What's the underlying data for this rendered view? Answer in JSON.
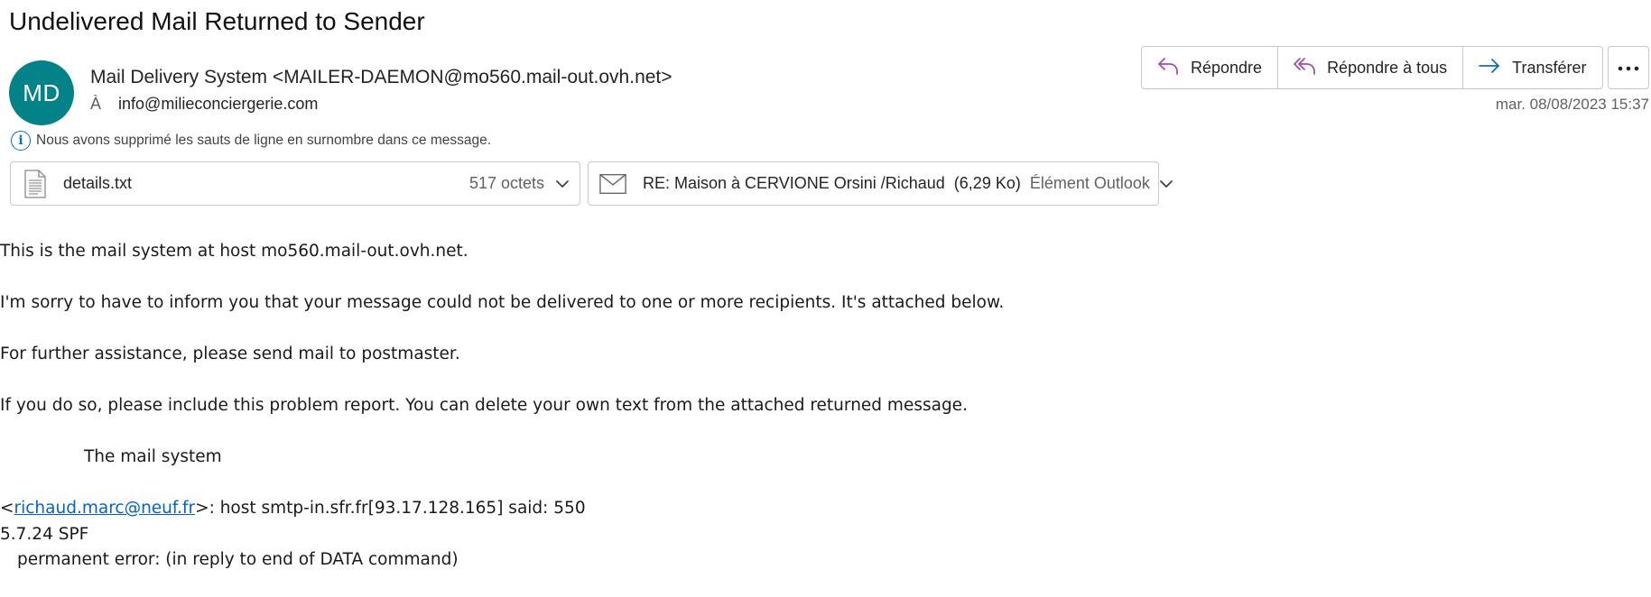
{
  "message": {
    "subject": "Undelivered Mail Returned to Sender",
    "avatar_initials": "MD",
    "avatar_color": "#038387",
    "sender": "Mail Delivery System <MAILER-DAEMON@mo560.mail-out.ovh.net>",
    "to_label": "À",
    "to": "info@milieconciergerie.com",
    "date": "mar. 08/08/2023 15:37",
    "info_notice": "Nous avons supprimé les sauts de ligne en surnombre dans ce message."
  },
  "actions": {
    "reply": "Répondre",
    "reply_all": "Répondre à tous",
    "forward": "Transférer",
    "more_icon": "more-dots-icon",
    "accent": "#a34bb0"
  },
  "attachments": [
    {
      "name": "details.txt",
      "size": "517 octets",
      "icon": "text-file-icon"
    },
    {
      "name": "RE: Maison à CERVIONE Orsini /Richaud",
      "size": "(6,29 Ko)",
      "type": "Élément Outlook",
      "icon": "envelope-icon"
    }
  ],
  "body": {
    "line1": "This is the mail system at host mo560.mail-out.ovh.net.",
    "line2": "I'm sorry to have to inform you that your message could not be delivered to one or more recipients. It's attached below.",
    "line3": "For further assistance, please send mail to postmaster.",
    "line4": "If you do so, please include this problem report. You can delete your own text from the attached returned message.",
    "signature": "The mail system",
    "error_prefix": "<",
    "error_email": "richaud.marc@neuf.fr",
    "error_suffix": ">: host smtp-in.sfr.fr[93.17.128.165] said: 550",
    "error_code": "5.7.24 SPF",
    "error_detail": "permanent error:  (in reply to end of DATA command)"
  }
}
